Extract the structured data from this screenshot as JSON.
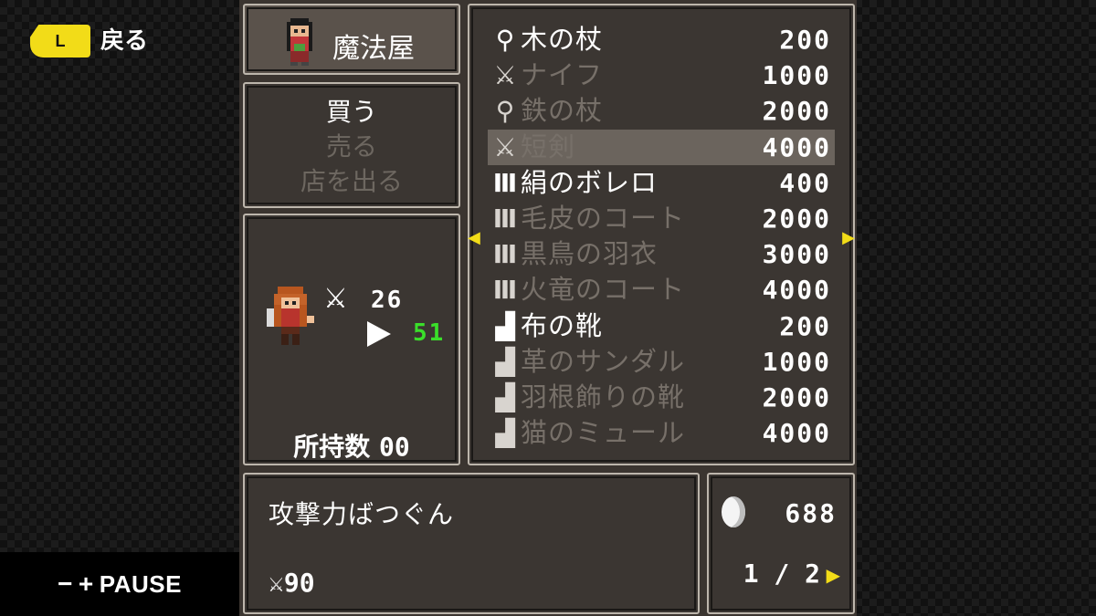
{
  "hud": {
    "back_key": "L",
    "back_label": "戻る",
    "pause_minus": "−",
    "pause_plus": "+",
    "pause_label": "PAUSE"
  },
  "shop": {
    "title": "魔法屋",
    "menu": [
      {
        "label": "買う",
        "enabled": true
      },
      {
        "label": "売る",
        "enabled": false
      },
      {
        "label": "店を出る",
        "enabled": false
      }
    ]
  },
  "status": {
    "attack_current": "26",
    "attack_new": "51",
    "owned_label": "所持数",
    "owned_count": "00"
  },
  "items": [
    {
      "icon": "staff-icon",
      "glyph": "⚲",
      "name": "木の杖",
      "price": "200",
      "affordable": true,
      "selected": false
    },
    {
      "icon": "sword-icon",
      "glyph": "⚔",
      "name": "ナイフ",
      "price": "1000",
      "affordable": false,
      "selected": false
    },
    {
      "icon": "staff-icon",
      "glyph": "⚲",
      "name": "鉄の杖",
      "price": "2000",
      "affordable": false,
      "selected": false
    },
    {
      "icon": "sword-icon",
      "glyph": "⚔",
      "name": "短剣",
      "price": "4000",
      "affordable": false,
      "selected": true
    },
    {
      "icon": "armor-icon",
      "glyph": "Ⅲ",
      "name": "絹のボレロ",
      "price": "400",
      "affordable": true,
      "selected": false
    },
    {
      "icon": "armor-icon",
      "glyph": "Ⅲ",
      "name": "毛皮のコート",
      "price": "2000",
      "affordable": false,
      "selected": false
    },
    {
      "icon": "armor-icon",
      "glyph": "Ⅲ",
      "name": "黒鳥の羽衣",
      "price": "3000",
      "affordable": false,
      "selected": false
    },
    {
      "icon": "armor-icon",
      "glyph": "Ⅲ",
      "name": "火竜のコート",
      "price": "4000",
      "affordable": false,
      "selected": false
    },
    {
      "icon": "boot-icon",
      "glyph": "▟",
      "name": "布の靴",
      "price": "200",
      "affordable": true,
      "selected": false
    },
    {
      "icon": "boot-icon",
      "glyph": "▟",
      "name": "革のサンダル",
      "price": "1000",
      "affordable": false,
      "selected": false
    },
    {
      "icon": "boot-icon",
      "glyph": "▟",
      "name": "羽根飾りの靴",
      "price": "2000",
      "affordable": false,
      "selected": false
    },
    {
      "icon": "boot-icon",
      "glyph": "▟",
      "name": "猫のミュール",
      "price": "4000",
      "affordable": false,
      "selected": false
    }
  ],
  "description": {
    "text": "攻撃力ばつぐん",
    "stat_value": "90"
  },
  "wallet": {
    "gold": "688",
    "page": "1 / 2"
  },
  "colors": {
    "accent_yellow": "#f2dc18",
    "stat_up_green": "#3adf2a",
    "dim_text": "#777069"
  }
}
